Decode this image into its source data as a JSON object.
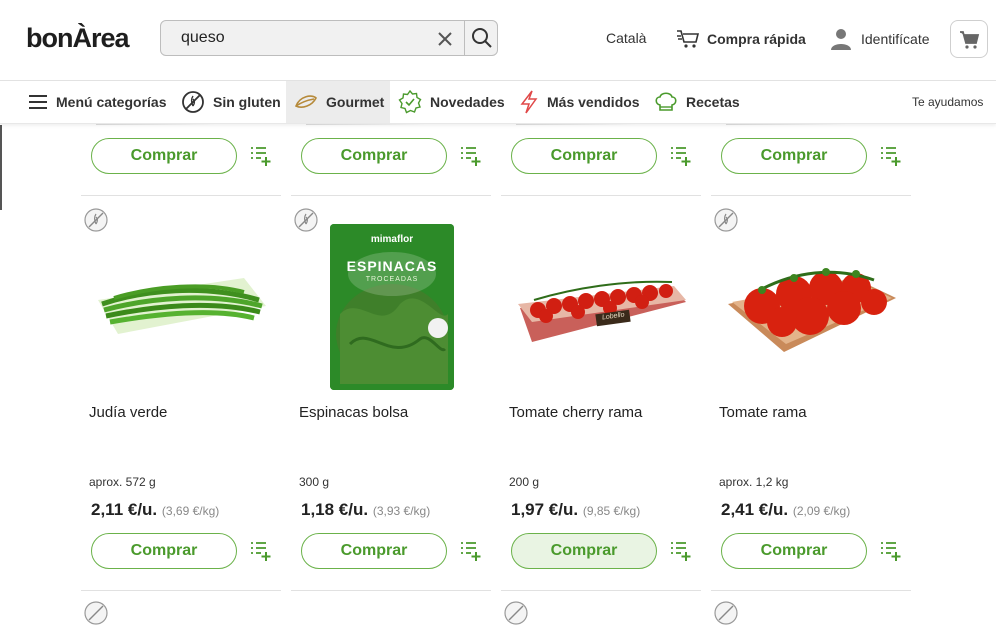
{
  "header": {
    "logo_text": "bonÀrea",
    "search": {
      "value": "queso",
      "placeholder": ""
    },
    "language_link": "Català",
    "quick_buy_label": "Compra rápida",
    "login_label": "Identifícate"
  },
  "nav": {
    "items": [
      {
        "label": "Menú categorías",
        "icon": "hamburger-icon"
      },
      {
        "label": "Sin gluten",
        "icon": "gluten-free-icon"
      },
      {
        "label": "Gourmet",
        "icon": "gourmet-icon",
        "active": true
      },
      {
        "label": "Novedades",
        "icon": "new-badge-icon"
      },
      {
        "label": "Más vendidos",
        "icon": "lightning-icon"
      },
      {
        "label": "Recetas",
        "icon": "chef-hat-icon"
      }
    ],
    "help_label": "Te ayudamos"
  },
  "top_row": {
    "buy_label": "Comprar"
  },
  "products": [
    {
      "name": "Judía verde",
      "weight": "aprox. 572 g",
      "price": "2,11 €/u.",
      "price_per_kg": "(3,69 €/kg)",
      "buy_label": "Comprar",
      "gluten_free": true
    },
    {
      "name": "Espinacas bolsa",
      "weight": "300 g",
      "price": "1,18 €/u.",
      "price_per_kg": "(3,93 €/kg)",
      "buy_label": "Comprar",
      "gluten_free": true,
      "package_brand": "mimaflor",
      "package_title": "ESPINACAS",
      "package_subtitle": "TROCEADAS"
    },
    {
      "name": "Tomate cherry rama",
      "weight": "200 g",
      "price": "1,97 €/u.",
      "price_per_kg": "(9,85 €/kg)",
      "buy_label": "Comprar",
      "gluten_free": false,
      "hovered": true,
      "package_label": "Lobello"
    },
    {
      "name": "Tomate rama",
      "weight": "aprox. 1,2 kg",
      "price": "2,41 €/u.",
      "price_per_kg": "(2,09 €/kg)",
      "buy_label": "Comprar",
      "gluten_free": true
    }
  ],
  "colors": {
    "accent_green": "#4a9a2c",
    "border_green": "#6bb24a",
    "hover_bg": "#e9f4e3"
  }
}
